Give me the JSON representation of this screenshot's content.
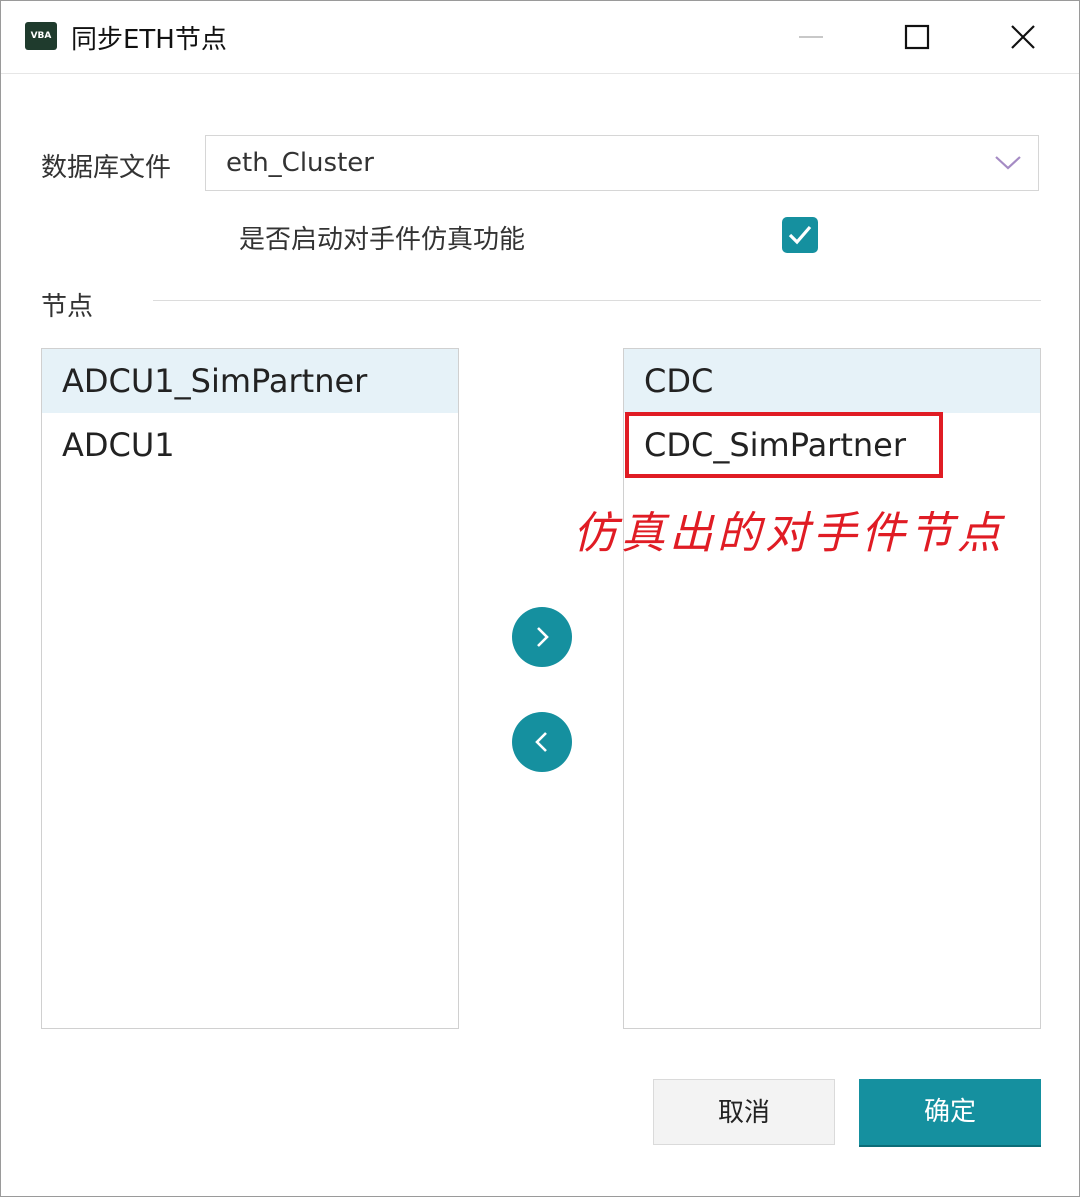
{
  "window": {
    "title": "同步ETH节点",
    "app_icon_text": "VBA"
  },
  "form": {
    "db_label": "数据库文件",
    "db_value": "eth_Cluster",
    "sim_label": "是否启动对手件仿真功能",
    "sim_checked": true,
    "nodes_label": "节点"
  },
  "left_list": {
    "items": [
      {
        "label": "ADCU1_SimPartner",
        "selected": true
      },
      {
        "label": "ADCU1",
        "selected": false
      }
    ]
  },
  "right_list": {
    "items": [
      {
        "label": "CDC",
        "selected": true
      },
      {
        "label": "CDC_SimPartner",
        "selected": false
      }
    ]
  },
  "annotation": {
    "text": "仿真出的对手件节点",
    "color": "#e01c24"
  },
  "buttons": {
    "cancel": "取消",
    "ok": "确定"
  },
  "colors": {
    "accent": "#15909f",
    "selection": "#e6f2f8"
  },
  "icons": {
    "move_right": "chevron-right-icon",
    "move_left": "chevron-left-icon",
    "dropdown": "chevron-down-icon",
    "check": "check-icon"
  }
}
